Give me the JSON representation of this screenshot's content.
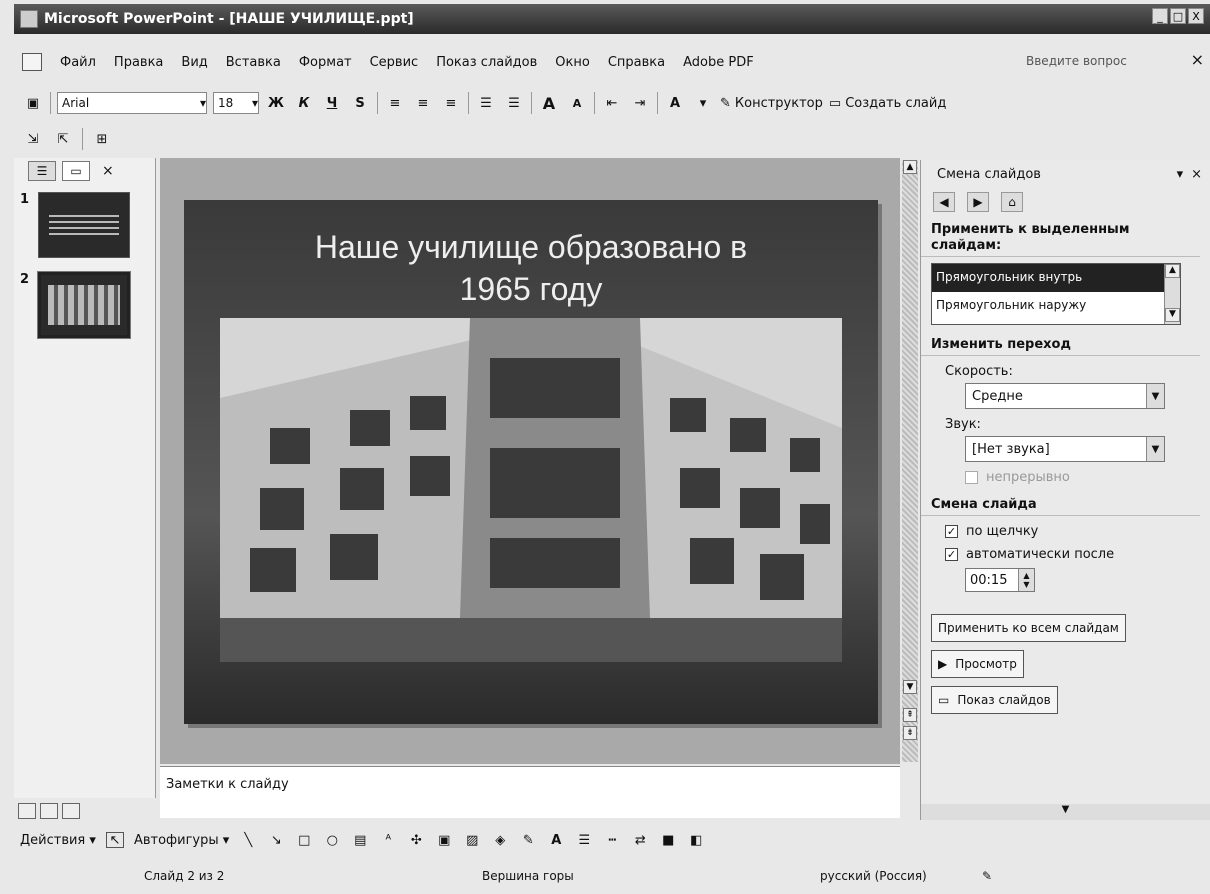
{
  "window": {
    "title": "Microsoft PowerPoint - [НАШЕ УЧИЛИЩЕ.ppt]",
    "controls": [
      "_",
      "□",
      "X"
    ]
  },
  "menu": {
    "items": [
      "Файл",
      "Правка",
      "Вид",
      "Вставка",
      "Формат",
      "Сервис",
      "Показ слайдов",
      "Окно",
      "Справка",
      "Adobe PDF"
    ],
    "help_placeholder": "Введите вопрос",
    "close": "×"
  },
  "toolbar": {
    "font": "Arial",
    "size": "18",
    "bold": "Ж",
    "italic": "К",
    "underline": "Ч",
    "shadow": "S",
    "grow_font": "A",
    "shrink_font": "A",
    "font_color": "A",
    "designer_label": "Конструктор",
    "new_slide_label": "Создать слайд"
  },
  "left_pane": {
    "close": "×",
    "slides": [
      {
        "number": "1"
      },
      {
        "number": "2"
      }
    ]
  },
  "slide": {
    "title_line1": "Наше училище образовано в",
    "title_line2": "1965 году"
  },
  "notes": {
    "placeholder": "Заметки к слайду"
  },
  "task_pane": {
    "title": "Смена слайдов",
    "close": "×",
    "apply_to_selected": "Применить к выделенным слайдам:",
    "effects": [
      "Прямоугольник внутрь",
      "Прямоугольник наружу"
    ],
    "modify_transition": "Изменить переход",
    "speed_label": "Скорость:",
    "speed_value": "Средне",
    "sound_label": "Звук:",
    "sound_value": "[Нет звука]",
    "loop_label": "непрерывно",
    "advance_section": "Смена слайда",
    "on_click_label": "по щелчку",
    "auto_after_label": "автоматически после",
    "auto_after_value": "00:15",
    "apply_all_button": "Применить ко всем слайдам",
    "preview_button": "Просмотр",
    "slideshow_button": "Показ слайдов"
  },
  "draw_toolbar": {
    "actions_label": "Действия",
    "autoshapes_label": "Автофигуры"
  },
  "status": {
    "slide_info": "Слайд 2 из 2",
    "design": "Вершина горы",
    "language": "русский (Россия)"
  }
}
